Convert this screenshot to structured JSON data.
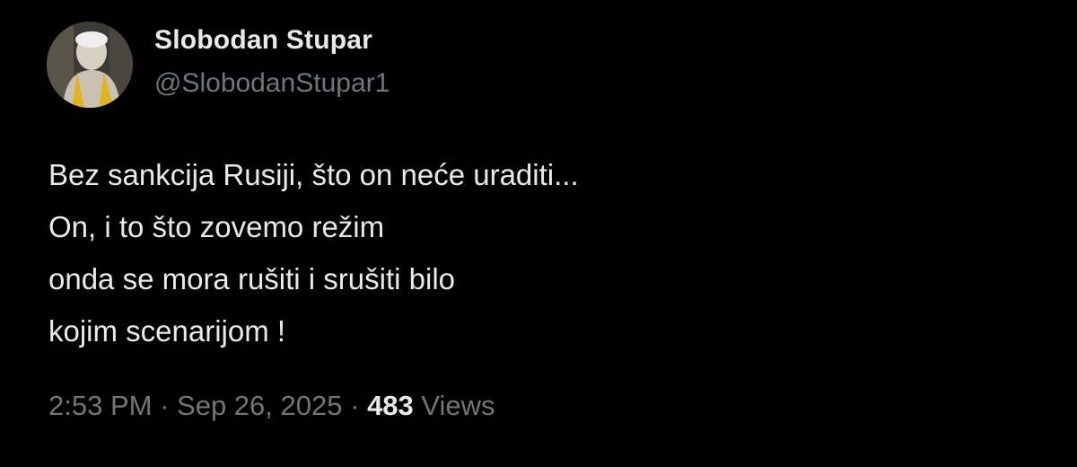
{
  "author": {
    "display_name": "Slobodan Stupar",
    "handle": "@SlobodanStupar1"
  },
  "tweet": {
    "lines": [
      "Bez sankcija Rusiji, što on neće uraditi...",
      "On, i to što zovemo režim",
      "onda se mora rušiti i srušiti bilo",
      "kojim scenarijom !"
    ]
  },
  "meta": {
    "time": "2:53 PM",
    "separator": "·",
    "date": "Sep 26, 2025",
    "views_count": "483",
    "views_label": "Views"
  },
  "colors": {
    "background": "#000000",
    "primary_text": "#e7e9ea",
    "secondary_text": "#71767b"
  }
}
